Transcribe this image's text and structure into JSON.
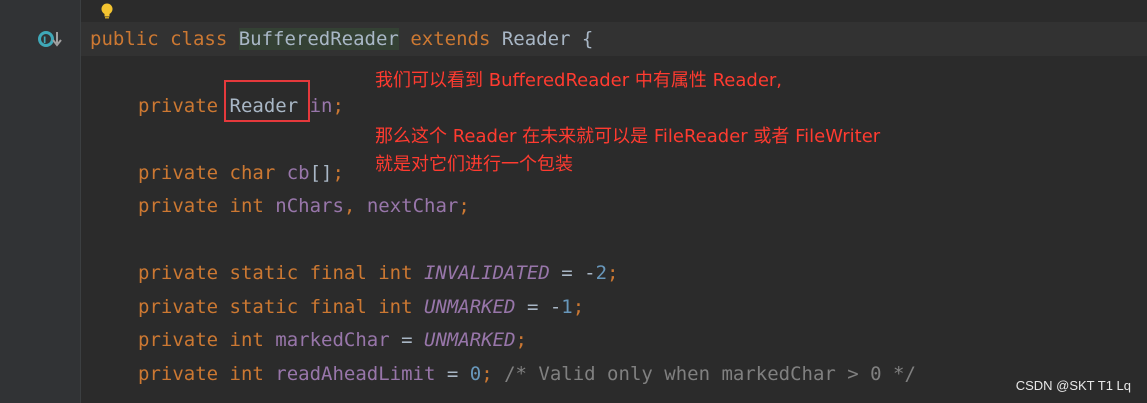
{
  "editor": {
    "lines": [
      [
        {
          "t": "public class ",
          "c": "kw"
        },
        {
          "t": "BufferedReader",
          "c": "cls hl-name"
        },
        {
          "t": " extends ",
          "c": "kw"
        },
        {
          "t": "Reader {",
          "c": "plain"
        }
      ],
      [
        {
          "t": "private ",
          "c": "kw"
        },
        {
          "t": "Reader ",
          "c": "plain"
        },
        {
          "t": "in",
          "c": "fld"
        },
        {
          "t": ";",
          "c": "punct"
        }
      ],
      [
        {
          "t": "private char ",
          "c": "kw"
        },
        {
          "t": "cb",
          "c": "fld"
        },
        {
          "t": "[]",
          "c": "plain"
        },
        {
          "t": ";",
          "c": "punct"
        }
      ],
      [
        {
          "t": "private int ",
          "c": "kw"
        },
        {
          "t": "nChars",
          "c": "fld"
        },
        {
          "t": ", ",
          "c": "punct"
        },
        {
          "t": "nextChar",
          "c": "fld"
        },
        {
          "t": ";",
          "c": "punct"
        }
      ],
      [
        {
          "t": "private static final int ",
          "c": "kw"
        },
        {
          "t": "INVALIDATED",
          "c": "cst"
        },
        {
          "t": " = -",
          "c": "plain"
        },
        {
          "t": "2",
          "c": "num"
        },
        {
          "t": ";",
          "c": "punct"
        }
      ],
      [
        {
          "t": "private static final int ",
          "c": "kw"
        },
        {
          "t": "UNMARKED",
          "c": "cst"
        },
        {
          "t": " = -",
          "c": "plain"
        },
        {
          "t": "1",
          "c": "num"
        },
        {
          "t": ";",
          "c": "punct"
        }
      ],
      [
        {
          "t": "private int ",
          "c": "kw"
        },
        {
          "t": "markedChar",
          "c": "fld"
        },
        {
          "t": " = ",
          "c": "plain"
        },
        {
          "t": "UNMARKED",
          "c": "cst"
        },
        {
          "t": ";",
          "c": "punct"
        }
      ],
      [
        {
          "t": "private int ",
          "c": "kw"
        },
        {
          "t": "readAheadLimit",
          "c": "fld"
        },
        {
          "t": " = ",
          "c": "plain"
        },
        {
          "t": "0",
          "c": "num"
        },
        {
          "t": "; ",
          "c": "punct"
        },
        {
          "t": "/* Valid only when markedChar > 0 */",
          "c": "cmt"
        }
      ]
    ]
  },
  "annotations": {
    "line1": "我们可以看到 BufferedReader 中有属性 Reader,",
    "line2": "那么这个 Reader 在未来就可以是 FileReader 或者 FileWriter",
    "line3": "就是对它们进行一个包装"
  },
  "watermark": "CSDN @SKT T1 Lq",
  "icons": {
    "bulb": "lightbulb-icon",
    "gutter": "implemented-override-icon"
  },
  "colors": {
    "background": "#2b2b2b",
    "keyword": "#cc7832",
    "field": "#9876aa",
    "number": "#6897bb",
    "comment": "#808080",
    "annotation": "#ff3b30"
  }
}
